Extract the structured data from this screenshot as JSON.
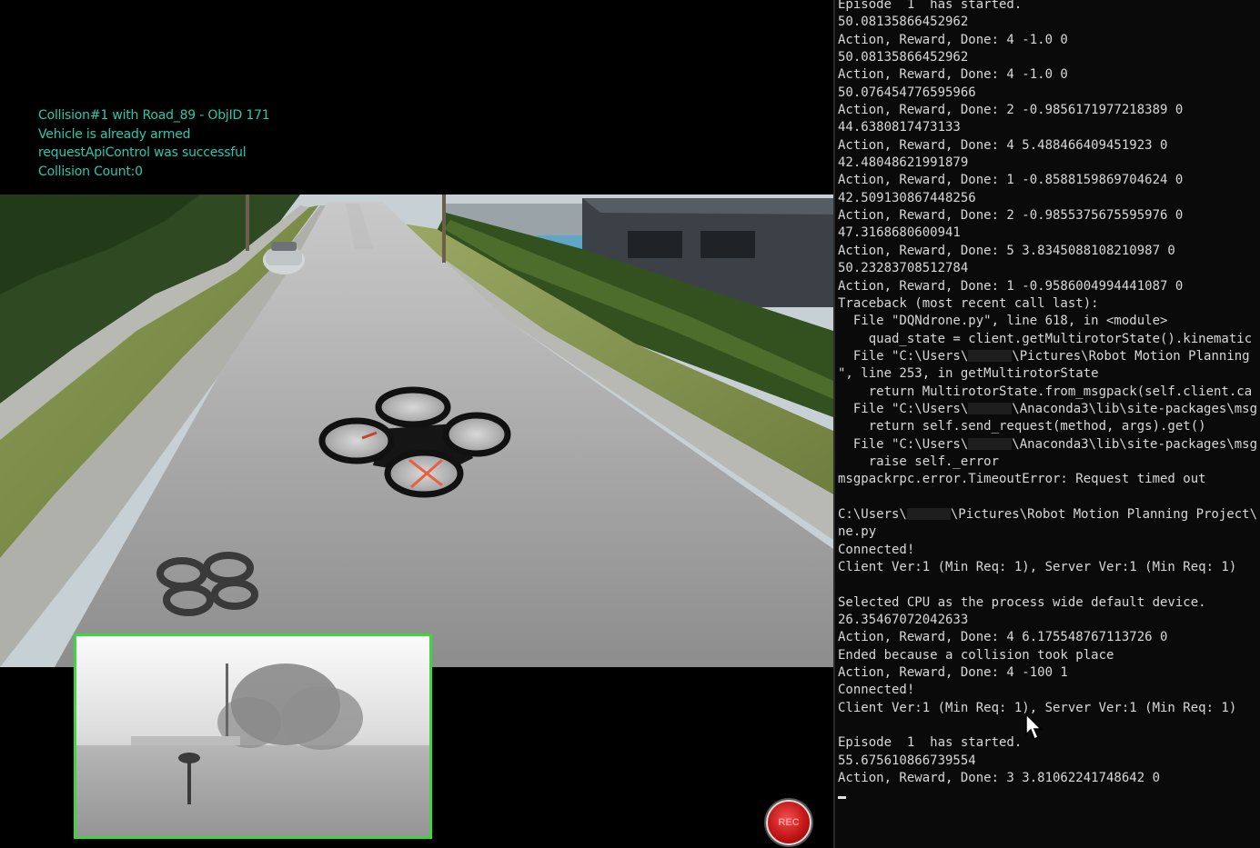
{
  "hud": {
    "lines": [
      "Collision#1 with Road_89 - ObjID 171",
      "Vehicle is already armed",
      "requestApiControl was successful",
      "Collision Count:0"
    ]
  },
  "record_button": {
    "label": "REC"
  },
  "console": {
    "lines": [
      "Episode  1  has started.",
      "50.08135866452962",
      "Action, Reward, Done: 4 -1.0 0",
      "50.08135866452962",
      "Action, Reward, Done: 4 -1.0 0",
      "50.076454776595966",
      "Action, Reward, Done: 2 -0.9856171977218389 0",
      "44.6380817473133",
      "Action, Reward, Done: 4 5.488466409451923 0",
      "42.48048621991879",
      "Action, Reward, Done: 1 -0.8588159869704624 0",
      "42.509130867448256",
      "Action, Reward, Done: 2 -0.9855375675595976 0",
      "47.3168680600941",
      "Action, Reward, Done: 5 3.8345088108210987 0",
      "50.23283708512784",
      "Action, Reward, Done: 1 -0.9586004994441087 0",
      "Traceback (most recent call last):",
      "  File \"DQNdrone.py\", line 618, in <module>",
      "    quad_state = client.getMultirotorState().kinematic",
      "  File \"C:\\Users\\",
      "\", line 253, in getMultirotorState",
      "    return MultirotorState.from_msgpack(self.client.ca",
      "  File \"C:\\Users\\",
      "    return self.send_request(method, args).get()",
      "  File \"C:\\Users\\",
      "    raise self._error",
      "msgpackrpc.error.TimeoutError: Request timed out",
      "",
      "C:\\Users\\",
      "ne.py",
      "Connected!",
      "Client Ver:1 (Min Req: 1), Server Ver:1 (Min Req: 1)",
      "",
      "Selected CPU as the process wide default device.",
      "26.35467072042633",
      "Action, Reward, Done: 4 6.175548767113726 0",
      "Ended because a collision took place",
      "Action, Reward, Done: 4 -100 1",
      "Connected!",
      "Client Ver:1 (Min Req: 1), Server Ver:1 (Min Req: 1)",
      "",
      "Episode  1  has started.",
      "55.675610866739554",
      "Action, Reward, Done: 3 3.81062241748642 0"
    ],
    "redacted_tails": {
      "20": "\\Pictures\\Robot Motion Planning",
      "23": "\\Anaconda3\\lib\\site-packages\\msg",
      "25": "\\Anaconda3\\lib\\site-packages\\msg",
      "29": "\\Pictures\\Robot Motion Planning Project\\"
    }
  }
}
